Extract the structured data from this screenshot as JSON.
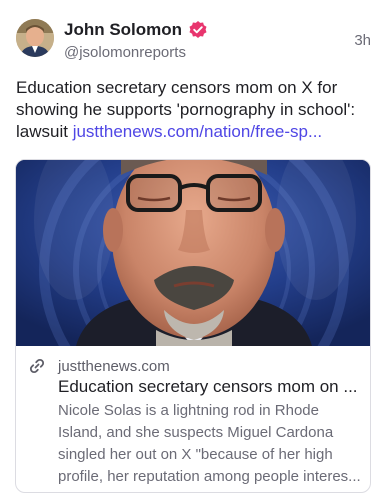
{
  "post": {
    "author": {
      "display_name": "John Solomon",
      "handle": "@jsolomonreports",
      "verified": true,
      "avatar_icon": "avatar-photo"
    },
    "timestamp": "3h",
    "text": "Education secretary censors mom on X for showing he supports 'pornography in school': lawsuit ",
    "link_text": "justthenews.com/nation/free-sp..."
  },
  "link_card": {
    "image_icon": "preview-photo",
    "domain": "justthenews.com",
    "title": "Education secretary censors mom on ...",
    "description": "Nicole Solas is a lightning rod in Rhode Island, and she suspects Miguel Cardona singled her out on X \"because of her high profile, her reputation among people interes...",
    "link_icon": "link-icon"
  },
  "colors": {
    "accent": "#4f46e5",
    "verified_badge": "#e8356e",
    "text_primary": "#1f1f24",
    "text_secondary": "#6b6b76"
  }
}
